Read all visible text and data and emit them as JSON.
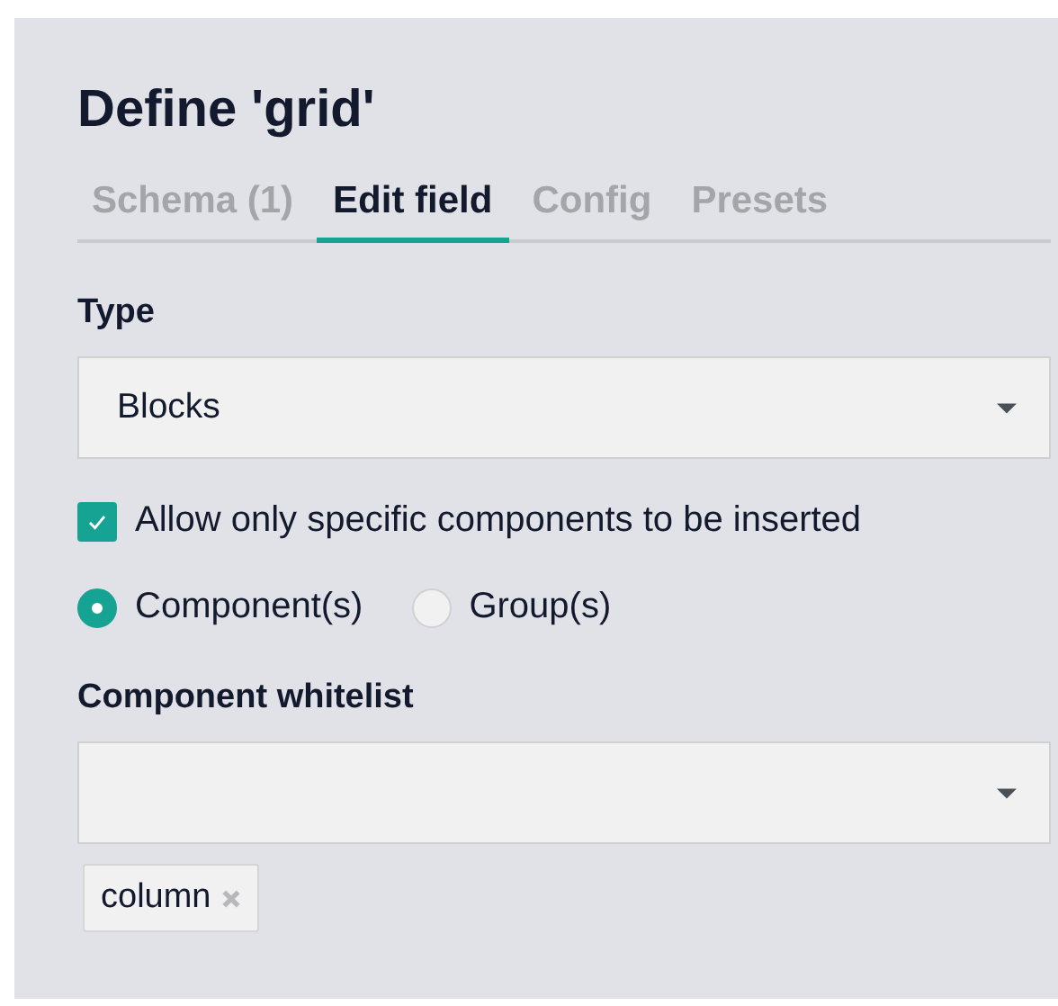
{
  "title": "Define 'grid'",
  "tabs": [
    {
      "label": "Schema (1)",
      "selected": false
    },
    {
      "label": "Edit field",
      "selected": true
    },
    {
      "label": "Config",
      "selected": false
    },
    {
      "label": "Presets",
      "selected": false
    }
  ],
  "type_field": {
    "label": "Type",
    "value": "Blocks"
  },
  "restrict": {
    "label": "Allow only specific components to be inserted",
    "checked": true
  },
  "radios": [
    {
      "label": "Component(s)",
      "selected": true
    },
    {
      "label": "Group(s)",
      "selected": false
    }
  ],
  "whitelist": {
    "label": "Component whitelist",
    "tags": [
      "column"
    ]
  }
}
